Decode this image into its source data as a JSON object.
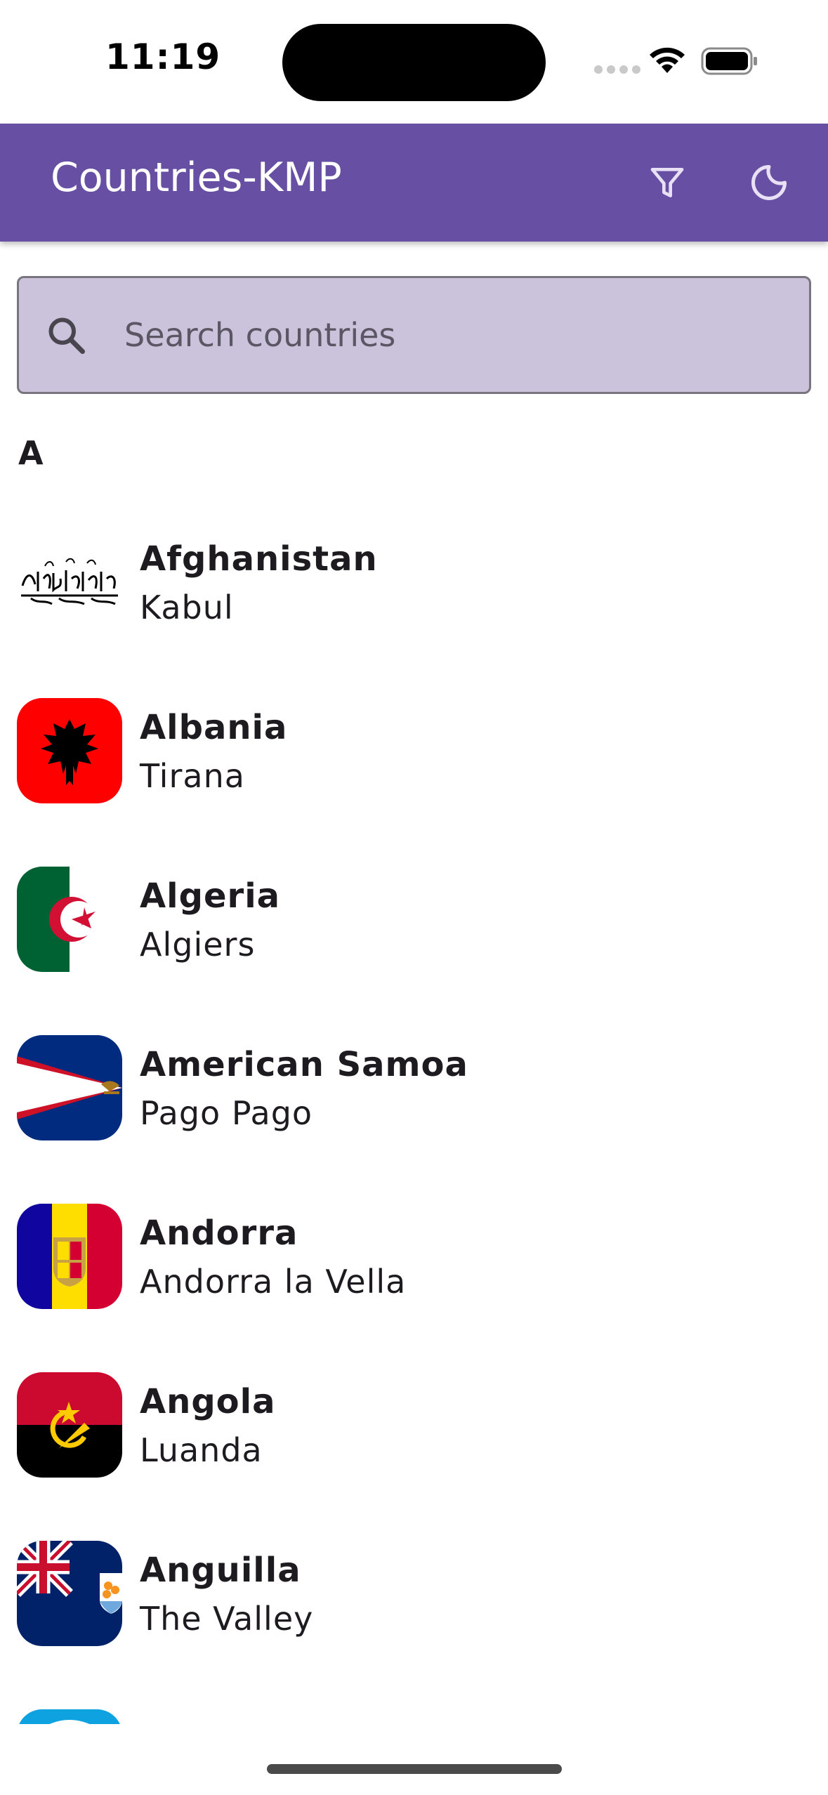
{
  "status_bar": {
    "time": "11:19"
  },
  "app_bar": {
    "title": "Countries-KMP",
    "filter_icon": "filter-icon",
    "theme_icon": "dark-mode-moon-icon",
    "background": "#6750a4"
  },
  "search": {
    "placeholder": "Search countries",
    "value": "",
    "icon": "search-icon"
  },
  "section": {
    "letter": "A"
  },
  "countries": [
    {
      "name": "Afghanistan",
      "capital": "Kabul",
      "flag": "afghanistan-flag"
    },
    {
      "name": "Albania",
      "capital": "Tirana",
      "flag": "albania-flag"
    },
    {
      "name": "Algeria",
      "capital": "Algiers",
      "flag": "algeria-flag"
    },
    {
      "name": "American Samoa",
      "capital": "Pago Pago",
      "flag": "american-samoa-flag"
    },
    {
      "name": "Andorra",
      "capital": "Andorra la Vella",
      "flag": "andorra-flag"
    },
    {
      "name": "Angola",
      "capital": "Luanda",
      "flag": "angola-flag"
    },
    {
      "name": "Anguilla",
      "capital": "The Valley",
      "flag": "anguilla-flag"
    }
  ]
}
